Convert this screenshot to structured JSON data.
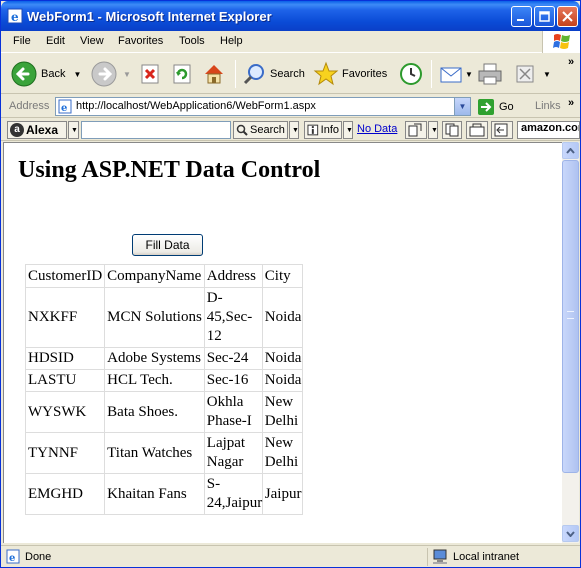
{
  "window": {
    "title": "WebForm1 - Microsoft Internet Explorer"
  },
  "menu": [
    "File",
    "Edit",
    "View",
    "Favorites",
    "Tools",
    "Help"
  ],
  "toolbar": {
    "back_label": "Back",
    "search_label": "Search",
    "favorites_label": "Favorites"
  },
  "address": {
    "label": "Address",
    "url": "http://localhost/WebApplication6/WebForm1.aspx",
    "go_label": "Go",
    "links_label": "Links"
  },
  "alexa": {
    "logo_label": "Alexa",
    "search_label": "Search",
    "info_label": "Info",
    "no_data_label": "No Data",
    "amazon_label": "amazon.com"
  },
  "page": {
    "title": "Using ASP.NET Data Control",
    "fill_button_label": "Fill Data"
  },
  "grid": {
    "headers": [
      "CustomerID",
      "CompanyName",
      "Address",
      "City"
    ],
    "rows": [
      [
        "NXKFF",
        "MCN Solutions",
        "D-45,Sec-12",
        "Noida"
      ],
      [
        "HDSID",
        "Adobe Systems",
        "Sec-24",
        "Noida"
      ],
      [
        "LASTU",
        "HCL Tech.",
        "Sec-16",
        "Noida"
      ],
      [
        "WYSWK",
        "Bata Shoes.",
        "Okhla Phase-I",
        "New Delhi"
      ],
      [
        "TYNNF",
        "Titan Watches",
        "Lajpat Nagar",
        "New Delhi"
      ],
      [
        "EMGHD",
        "Khaitan Fans",
        "S-24,Jaipur",
        "Jaipur"
      ]
    ]
  },
  "status": {
    "text": "Done",
    "zone": "Local intranet"
  },
  "colors": {
    "titlebar": "#0A4BD6",
    "chrome": "#ECE9D8",
    "link": "#0000CC"
  }
}
